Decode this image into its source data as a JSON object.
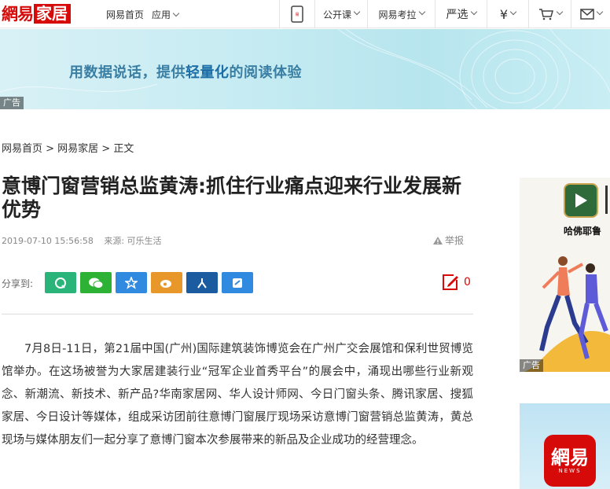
{
  "nav": {
    "logo_netease": "網易",
    "logo_home": "家居",
    "left_links": [
      "网易首页",
      "应用"
    ],
    "right_items": [
      {
        "label": "",
        "icon": "phone-icon"
      },
      {
        "label": "公开课"
      },
      {
        "label": "网易考拉"
      },
      {
        "label": "严选"
      },
      {
        "label": "",
        "icon": "yen-icon"
      },
      {
        "label": "",
        "icon": "cart-icon"
      },
      {
        "label": "",
        "icon": "mail-icon"
      }
    ]
  },
  "banner": {
    "text_before": "用数据说话，提供",
    "text_em": "轻量化",
    "text_after": "的阅读体验",
    "ad_tag": "广告"
  },
  "article": {
    "breadcrumb": "网易首页 > 网易家居 > 正文",
    "title": "意博门窗营销总监黄涛:抓住行业痛点迎来行业发展新优势",
    "date": "2019-07-10 15:56:58",
    "source": "来源: 可乐生活",
    "report": "举报",
    "share_label": "分享到:",
    "share_buttons": [
      {
        "name": "qq",
        "color": "#2bb47a"
      },
      {
        "name": "wechat",
        "color": "#2eb236"
      },
      {
        "name": "qzone",
        "color": "#2f8ae0"
      },
      {
        "name": "weibo",
        "color": "#e8972a"
      },
      {
        "name": "renren",
        "color": "#1a5c9f"
      },
      {
        "name": "yixin",
        "color": "#2f8ae0"
      }
    ],
    "comment_count": "0",
    "body": "7月8日-11日，第21届中国(广州)国际建筑装饰博览会在广州广交会展馆和保利世贸博览馆举办。在这场被誉为大家居建装行业“冠军企业首秀平台”的展会中，涌现出哪些行业新观念、新潮流、新技术、新产品?华南家居网、华人设计师网、今日门窗头条、腾讯家居、搜狐家居、今日设计等媒体，组成采访团前往意博门窗展厅现场采访意博门窗营销总监黄涛，黄总现场与媒体朋友们一起分享了意博门窗本次参展带来的新品及企业成功的经营理念。"
  },
  "sidebar": {
    "ad1_caption": "哈佛耶鲁",
    "ad1_tag": "广告",
    "ad2_logo": "網易",
    "ad2_logo_sub": "NEWS"
  }
}
